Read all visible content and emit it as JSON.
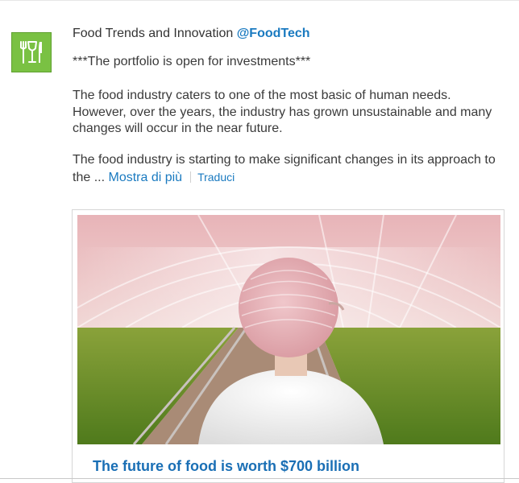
{
  "post": {
    "author_name": "Food Trends and Innovation",
    "author_handle": "@FoodTech",
    "avatar_icon": "fork-glass-knife-icon",
    "avatar_color": "#7ac143",
    "line_1": "***The portfolio is open for investments***",
    "line_2": "The food industry caters to one of the most basic of human needs. However, over the years, the industry has grown unsustainable and many changes will occur in the near future.",
    "line_3": "The food industry is starting to make significant changes in its approach to the ...",
    "show_more_label": "Mostra di più",
    "translate_label": "Traduci"
  },
  "link_card": {
    "image_description": "woman-in-hairnet-greenhouse-photo",
    "title": "The future of food is worth $700 billion"
  },
  "colors": {
    "link": "#1a7ac0",
    "card_title": "#1a6fb5"
  }
}
